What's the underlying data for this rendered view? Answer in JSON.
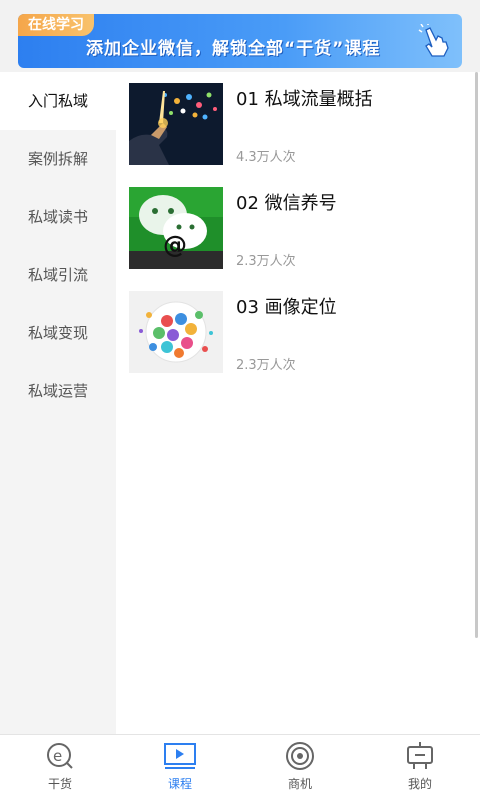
{
  "banner": {
    "tag": "在线学习",
    "text": "添加企业微信，解锁全部“干货”课程",
    "icon": "hand-pointer-icon"
  },
  "sidebar": {
    "items": [
      {
        "label": "入门私域",
        "active": true
      },
      {
        "label": "案例拆解",
        "active": false
      },
      {
        "label": "私域读书",
        "active": false
      },
      {
        "label": "私域引流",
        "active": false
      },
      {
        "label": "私域变现",
        "active": false
      },
      {
        "label": "私域运营",
        "active": false
      }
    ]
  },
  "courses": [
    {
      "title": "01 私域流量概括",
      "views": "4.3万人次",
      "thumb": "app-icons-hand-image"
    },
    {
      "title": "02 微信养号",
      "views": "2.3万人次",
      "thumb": "wechat-logo-image"
    },
    {
      "title": "03 画像定位",
      "views": "2.3万人次",
      "thumb": "people-avatars-image"
    }
  ],
  "nav": {
    "items": [
      {
        "label": "干货",
        "icon": "e-search-icon",
        "active": false
      },
      {
        "label": "课程",
        "icon": "video-play-icon",
        "active": true
      },
      {
        "label": "商机",
        "icon": "circle-target-icon",
        "active": false
      },
      {
        "label": "我的",
        "icon": "robot-profile-icon",
        "active": false
      }
    ]
  },
  "colors": {
    "accent": "#2d7ff0",
    "tag": "#f5a64a"
  }
}
